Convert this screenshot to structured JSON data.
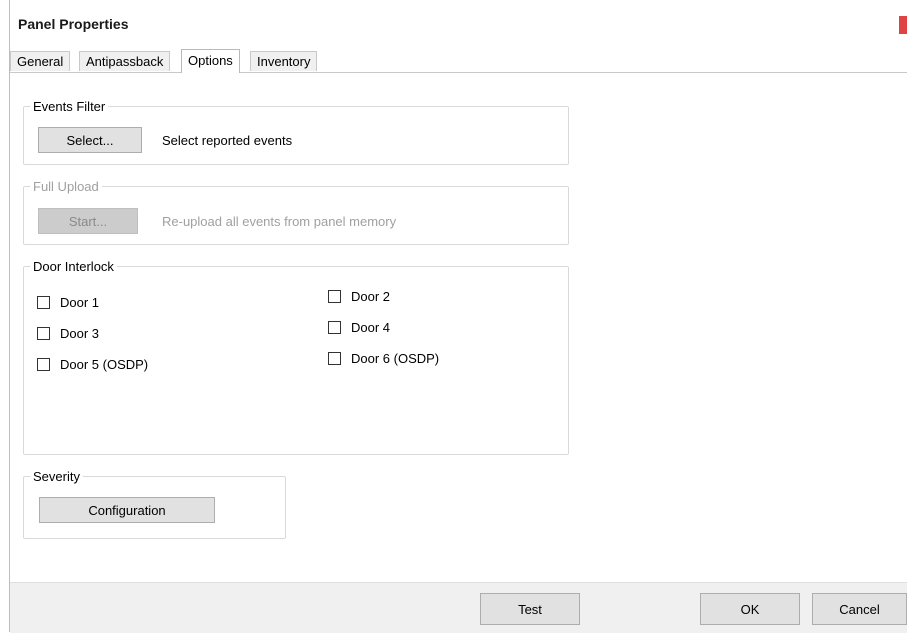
{
  "window": {
    "title": "Panel Properties"
  },
  "tabs": [
    {
      "label": "General"
    },
    {
      "label": "Antipassback"
    },
    {
      "label": "Options",
      "active": true
    },
    {
      "label": "Inventory"
    }
  ],
  "events_filter": {
    "legend": "Events Filter",
    "button_label": "Select...",
    "description": "Select reported events"
  },
  "full_upload": {
    "legend": "Full Upload",
    "button_label": "Start...",
    "description": "Re-upload all events from panel memory",
    "enabled": false
  },
  "door_interlock": {
    "legend": "Door Interlock",
    "doors": [
      {
        "label": "Door 1",
        "checked": false
      },
      {
        "label": "Door 2",
        "checked": false
      },
      {
        "label": "Door 3",
        "checked": false
      },
      {
        "label": "Door 4",
        "checked": false
      },
      {
        "label": "Door 5 (OSDP)",
        "checked": false
      },
      {
        "label": "Door 6 (OSDP)",
        "checked": false
      }
    ]
  },
  "severity": {
    "legend": "Severity",
    "button_label": "Configuration"
  },
  "footer": {
    "test_label": "Test",
    "ok_label": "OK",
    "cancel_label": "Cancel"
  },
  "colors": {
    "close_button": "#e04343",
    "button_face": "#e1e1e1",
    "footer_bg": "#f0f0f0"
  }
}
